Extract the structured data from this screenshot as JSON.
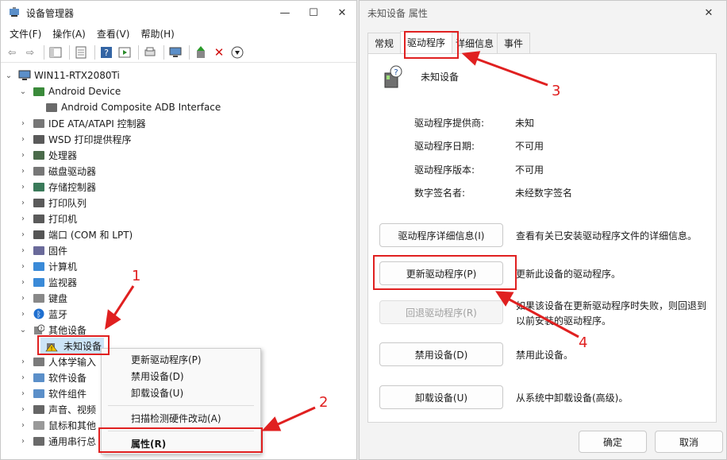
{
  "device_manager": {
    "title": "设备管理器",
    "controls": {
      "minimize": "—",
      "maximize": "☐",
      "close": "✕"
    },
    "menu": [
      "文件(F)",
      "操作(A)",
      "查看(V)",
      "帮助(H)"
    ],
    "tree": {
      "root": "WIN11-RTX2080Ti",
      "items": [
        {
          "label": "Android Device",
          "expanded": true
        },
        {
          "label": "Android Composite ADB Interface",
          "child": true
        },
        {
          "label": "IDE ATA/ATAPI 控制器"
        },
        {
          "label": "WSD 打印提供程序"
        },
        {
          "label": "处理器"
        },
        {
          "label": "磁盘驱动器"
        },
        {
          "label": "存储控制器"
        },
        {
          "label": "打印队列"
        },
        {
          "label": "打印机"
        },
        {
          "label": "端口 (COM 和 LPT)"
        },
        {
          "label": "固件"
        },
        {
          "label": "计算机"
        },
        {
          "label": "监视器"
        },
        {
          "label": "键盘"
        },
        {
          "label": "蓝牙"
        },
        {
          "label": "其他设备",
          "expanded": true
        },
        {
          "label": "未知设备",
          "child": true,
          "selected": true
        },
        {
          "label": "人体学输入"
        },
        {
          "label": "软件设备"
        },
        {
          "label": "软件组件"
        },
        {
          "label": "声音、视频"
        },
        {
          "label": "鼠标和其他"
        },
        {
          "label": "通用串行总"
        }
      ]
    },
    "context_menu": {
      "update": "更新驱动程序(P)",
      "disable": "禁用设备(D)",
      "uninstall": "卸载设备(U)",
      "scan": "扫描检测硬件改动(A)",
      "properties": "属性(R)"
    }
  },
  "properties_dialog": {
    "title": "未知设备 属性",
    "close": "✕",
    "tabs": [
      "常规",
      "驱动程序",
      "详细信息",
      "事件"
    ],
    "device_name": "未知设备",
    "fields": [
      {
        "label": "驱动程序提供商:",
        "value": "未知"
      },
      {
        "label": "驱动程序日期:",
        "value": "不可用"
      },
      {
        "label": "驱动程序版本:",
        "value": "不可用"
      },
      {
        "label": "数字签名者:",
        "value": "未经数字签名"
      }
    ],
    "buttons": {
      "details": "驱动程序详细信息(I)",
      "update": "更新驱动程序(P)",
      "rollback": "回退驱动程序(R)",
      "disable": "禁用设备(D)",
      "uninstall": "卸载设备(U)",
      "ok": "确定",
      "cancel": "取消"
    },
    "descriptions": {
      "details": "查看有关已安装驱动程序文件的详细信息。",
      "update": "更新此设备的驱动程序。",
      "rollback_1": "如果该设备在更新驱动程序时失败，则回退到",
      "rollback_2": "以前安装的驱动程序。",
      "disable": "禁用此设备。",
      "uninstall": "从系统中卸载设备(高级)。"
    }
  },
  "annotations": [
    "1",
    "2",
    "3",
    "4"
  ],
  "colors": {
    "annotation": "#e02020",
    "selection": "#cce4f7"
  }
}
